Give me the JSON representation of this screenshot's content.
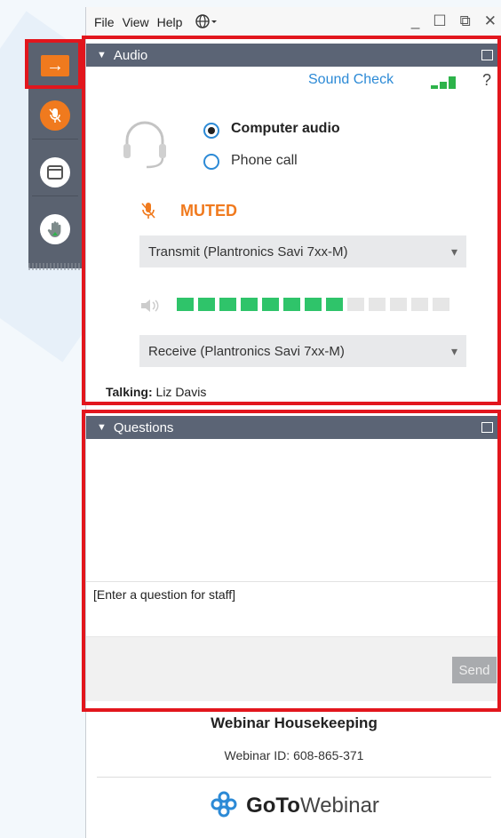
{
  "menu": {
    "file": "File",
    "view": "View",
    "help": "Help"
  },
  "icons": {
    "sidebar": [
      "arrow-right-icon",
      "mic-muted-icon",
      "window-icon",
      "hand-raise-icon"
    ],
    "window_controls": [
      "minimize-icon",
      "restore-icon",
      "close-icon"
    ],
    "headset": "headset-icon",
    "speaker": "speaker-icon",
    "globe": "globe-icon",
    "logo": "gotowebinar-logo-icon"
  },
  "colors": {
    "accent": "#f07a1e",
    "panel_header": "#5b6475",
    "link": "#2c8ad6",
    "muted": "#f07a1e",
    "meter_on": "#2fc46a",
    "highlight": "#e2161d"
  },
  "audio": {
    "title": "Audio",
    "sound_check": "Sound Check",
    "help": "?",
    "options": [
      {
        "label": "Computer audio",
        "selected": true
      },
      {
        "label": "Phone call",
        "selected": false
      }
    ],
    "muted_label": "MUTED",
    "transmit": "Transmit (Plantronics Savi 7xx-M)",
    "receive": "Receive (Plantronics Savi 7xx-M)",
    "meter_level": 0.6,
    "talking_label": "Talking:",
    "talking_name": "Liz Davis"
  },
  "questions": {
    "title": "Questions",
    "input_placeholder": "[Enter a question for staff]",
    "send_label": "Send"
  },
  "footer": {
    "title": "Webinar Housekeeping",
    "webinar_id": "Webinar ID: 608-865-371",
    "logo_bold": "GoTo",
    "logo_light": "Webinar"
  }
}
